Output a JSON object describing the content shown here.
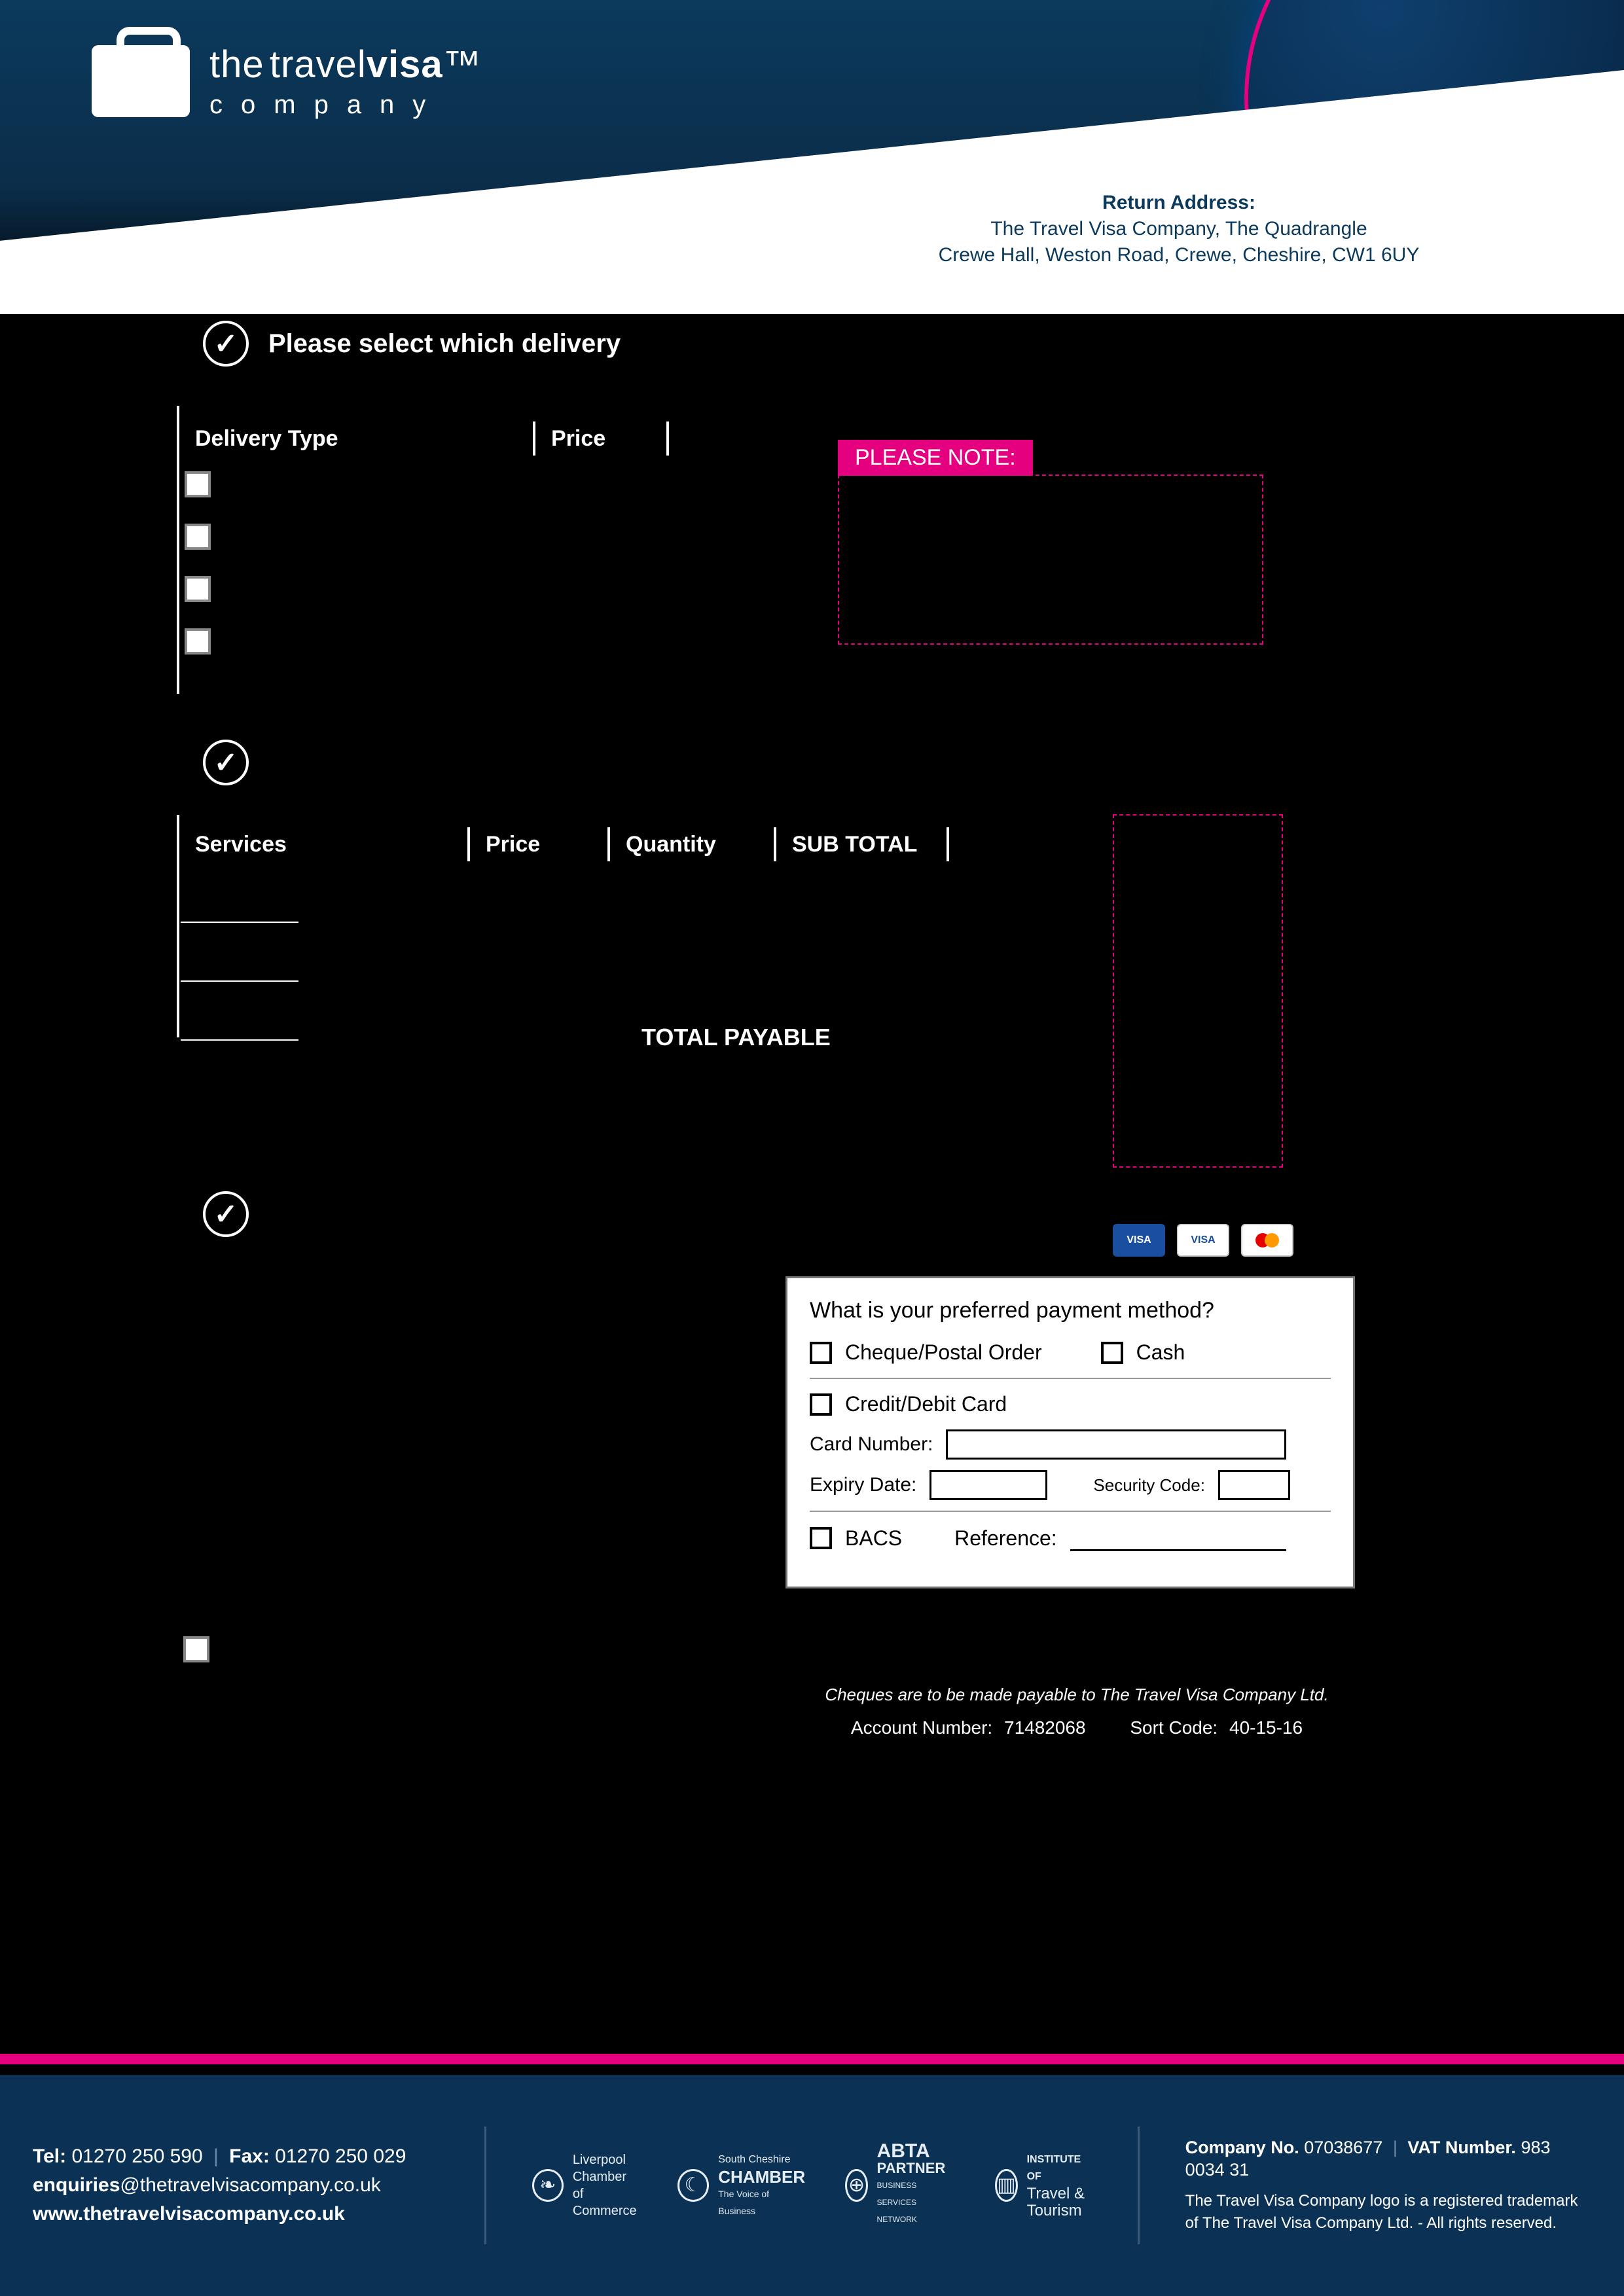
{
  "logo": {
    "the": "the",
    "travel": "travel",
    "visa": "visa",
    "tm": "™",
    "company": "company"
  },
  "return_address": {
    "label": "Return Address:",
    "line1": "The Travel Visa Company, The Quadrangle",
    "line2": "Crewe Hall, Weston Road, Crewe, Cheshire, CW1 6UY"
  },
  "steps": {
    "s7": "Please select which delivery",
    "s8": "",
    "s9": ""
  },
  "delivery_headers": {
    "type": "Delivery Type",
    "price": "Price"
  },
  "please_note": "PLEASE NOTE:",
  "services_headers": {
    "services": "Services",
    "price": "Price",
    "qty": "Quantity",
    "sub": "SUB TOTAL"
  },
  "total_payable": "TOTAL PAYABLE",
  "cards": {
    "visa": "VISA",
    "visa_debit": "VISA"
  },
  "payment": {
    "question": "What is your preferred payment method?",
    "cheque": "Cheque/Postal Order",
    "cash": "Cash",
    "card": "Credit/Debit Card",
    "cardnum": "Card Number:",
    "expiry": "Expiry Date:",
    "sec": "Security Code:",
    "bacs": "BACS",
    "ref": "Reference:"
  },
  "cheque_note": "Cheques are to be made payable to The Travel Visa Company Ltd.",
  "account": {
    "num_lab": "Account Number:",
    "num": "71482068",
    "sort_lab": "Sort Code:",
    "sort": "40-15-16"
  },
  "footer": {
    "tel_lab": "Tel:",
    "tel": "01270 250 590",
    "fax_lab": "Fax:",
    "fax": "01270 250 029",
    "enq_user": "enquiries",
    "enq_dom": "@thetravelvisacompany.co.uk",
    "web": "www.thetravelvisacompany.co.uk",
    "p_liverpool1": "Liverpool",
    "p_liverpool2": "Chamber of",
    "p_liverpool3": "Commerce",
    "p_south1": "South Cheshire",
    "p_south2": "CHAMBER",
    "p_south3": "The Voice of Business",
    "p_abta1": "ABTA",
    "p_abta2": "PARTNER",
    "p_abta3": "BUSINESS SERVICES NETWORK",
    "p_itt1": "INSTITUTE OF",
    "p_itt2": "Travel & Tourism",
    "company_lab": "Company No.",
    "company": "07038677",
    "vat_lab": "VAT Number.",
    "vat": "983 0034 31",
    "legal": "The Travel Visa Company logo is a registered trademark of The Travel Visa Company Ltd. - All rights reserved."
  }
}
